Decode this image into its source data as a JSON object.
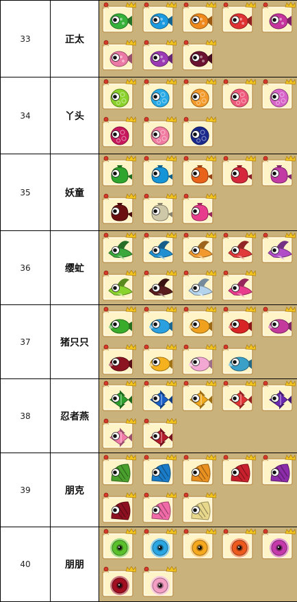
{
  "rows": [
    {
      "num": "33",
      "name": "正太",
      "fish": [
        {
          "type": "round",
          "color": "#36b23a",
          "icon": "round-fish-icon"
        },
        {
          "type": "round",
          "color": "#1c9be0",
          "icon": "round-fish-icon"
        },
        {
          "type": "round",
          "color": "#f08a1c",
          "icon": "round-fish-icon"
        },
        {
          "type": "round",
          "color": "#e03232",
          "icon": "round-fish-icon"
        },
        {
          "type": "round",
          "color": "#c4349c",
          "icon": "round-fish-icon"
        },
        {
          "type": "round",
          "color": "#ec7aa6",
          "icon": "round-fish-icon"
        },
        {
          "type": "round",
          "color": "#9b3ab4",
          "icon": "round-fish-icon"
        },
        {
          "type": "round",
          "color": "#6a1230",
          "icon": "round-fish-icon"
        }
      ]
    },
    {
      "num": "34",
      "name": "丫头",
      "fish": [
        {
          "type": "puff",
          "color": "#8ad22a",
          "icon": "puffer-fish-icon"
        },
        {
          "type": "puff",
          "color": "#27a9e6",
          "icon": "puffer-fish-icon"
        },
        {
          "type": "puff",
          "color": "#f39a2a",
          "icon": "puffer-fish-icon"
        },
        {
          "type": "puff",
          "color": "#ef5a7c",
          "icon": "puffer-fish-icon"
        },
        {
          "type": "puff",
          "color": "#d763c8",
          "icon": "puffer-fish-icon"
        },
        {
          "type": "puff",
          "color": "#c8185c",
          "icon": "puffer-fish-icon"
        },
        {
          "type": "puff",
          "color": "#f07aa0",
          "icon": "puffer-fish-icon"
        },
        {
          "type": "puff",
          "color": "#1a2a8c",
          "icon": "puffer-fish-icon"
        }
      ]
    },
    {
      "num": "35",
      "name": "妖童",
      "fish": [
        {
          "type": "bag",
          "color": "#2ea62e",
          "icon": "sack-fish-icon"
        },
        {
          "type": "bag",
          "color": "#1694d8",
          "icon": "sack-fish-icon"
        },
        {
          "type": "bag",
          "color": "#e8621a",
          "icon": "sack-fish-icon"
        },
        {
          "type": "bag",
          "color": "#d6283c",
          "icon": "sack-fish-icon"
        },
        {
          "type": "bag",
          "color": "#c23aa4",
          "icon": "sack-fish-icon"
        },
        {
          "type": "bag",
          "color": "#6a1010",
          "icon": "sack-fish-icon"
        },
        {
          "type": "bag",
          "color": "#cfc8a8",
          "icon": "sack-fish-icon"
        },
        {
          "type": "bag",
          "color": "#e83c8c",
          "icon": "sack-fish-icon"
        }
      ]
    },
    {
      "num": "36",
      "name": "缨虻",
      "fish": [
        {
          "type": "bird",
          "color": "#3aa83a",
          "icon": "bird-fish-icon"
        },
        {
          "type": "bird",
          "color": "#1e90d2",
          "icon": "bird-fish-icon"
        },
        {
          "type": "bird",
          "color": "#f29a2e",
          "icon": "bird-fish-icon"
        },
        {
          "type": "bird",
          "color": "#e03a3a",
          "icon": "bird-fish-icon"
        },
        {
          "type": "bird",
          "color": "#b04cc8",
          "icon": "bird-fish-icon"
        },
        {
          "type": "bird",
          "color": "#8ad22e",
          "icon": "bird-fish-icon"
        },
        {
          "type": "bird",
          "color": "#5a1c1c",
          "icon": "bird-fish-icon"
        },
        {
          "type": "bird",
          "color": "#b4d4ee",
          "icon": "bird-fish-icon"
        },
        {
          "type": "bird",
          "color": "#e83c8c",
          "icon": "bird-fish-icon"
        }
      ]
    },
    {
      "num": "37",
      "name": "猪只只",
      "fish": [
        {
          "type": "pig",
          "color": "#3aac2c",
          "icon": "pig-fish-icon"
        },
        {
          "type": "pig",
          "color": "#2aa0e0",
          "icon": "pig-fish-icon"
        },
        {
          "type": "pig",
          "color": "#f0a21e",
          "icon": "pig-fish-icon"
        },
        {
          "type": "pig",
          "color": "#d82424",
          "icon": "pig-fish-icon"
        },
        {
          "type": "pig",
          "color": "#c43a9c",
          "icon": "pig-fish-icon"
        },
        {
          "type": "pig",
          "color": "#8c1420",
          "icon": "pig-fish-icon"
        },
        {
          "type": "pig",
          "color": "#f6b21e",
          "icon": "pig-fish-icon"
        },
        {
          "type": "pig",
          "color": "#f2a8d2",
          "icon": "pig-fish-icon"
        },
        {
          "type": "pig",
          "color": "#3aa0c8",
          "icon": "pig-fish-icon"
        }
      ]
    },
    {
      "num": "38",
      "name": "忍者燕",
      "fish": [
        {
          "type": "ninja",
          "color": "#2c9e2c",
          "icon": "angelfish-icon"
        },
        {
          "type": "ninja",
          "color": "#1a5fc8",
          "icon": "angelfish-icon"
        },
        {
          "type": "ninja",
          "color": "#f0a81e",
          "icon": "angelfish-icon"
        },
        {
          "type": "ninja",
          "color": "#e03434",
          "icon": "angelfish-icon"
        },
        {
          "type": "ninja",
          "color": "#6a28b0",
          "icon": "angelfish-icon"
        },
        {
          "type": "ninja",
          "color": "#f07aa8",
          "icon": "angelfish-icon"
        },
        {
          "type": "ninja",
          "color": "#b41c2c",
          "icon": "angelfish-icon"
        }
      ]
    },
    {
      "num": "39",
      "name": "朋克",
      "fish": [
        {
          "type": "fan",
          "color": "#4aa02c",
          "icon": "fan-fish-icon"
        },
        {
          "type": "fan",
          "color": "#1a7cc8",
          "icon": "fan-fish-icon"
        },
        {
          "type": "fan",
          "color": "#e89020",
          "icon": "fan-fish-icon"
        },
        {
          "type": "fan",
          "color": "#c8202c",
          "icon": "fan-fish-icon"
        },
        {
          "type": "fan",
          "color": "#8c2ca8",
          "icon": "fan-fish-icon"
        },
        {
          "type": "fan",
          "color": "#8c1020",
          "icon": "fan-fish-icon"
        },
        {
          "type": "fan",
          "color": "#f06aa8",
          "icon": "fan-fish-icon"
        },
        {
          "type": "fan",
          "color": "#e8d88c",
          "icon": "fan-fish-icon"
        }
      ]
    },
    {
      "num": "40",
      "name": "朋朋",
      "fish": [
        {
          "type": "flower",
          "color": "#5ac02c",
          "icon": "flower-fish-icon"
        },
        {
          "type": "flower",
          "color": "#2aa6e2",
          "icon": "flower-fish-icon"
        },
        {
          "type": "flower",
          "color": "#f6a81e",
          "icon": "flower-fish-icon"
        },
        {
          "type": "flower",
          "color": "#ec5a1e",
          "icon": "flower-fish-icon"
        },
        {
          "type": "flower",
          "color": "#c43aaa",
          "icon": "flower-fish-icon"
        },
        {
          "type": "flower",
          "color": "#a01020",
          "icon": "flower-fish-icon"
        },
        {
          "type": "flower",
          "color": "#f3a0c4",
          "icon": "flower-fish-icon"
        }
      ]
    }
  ]
}
